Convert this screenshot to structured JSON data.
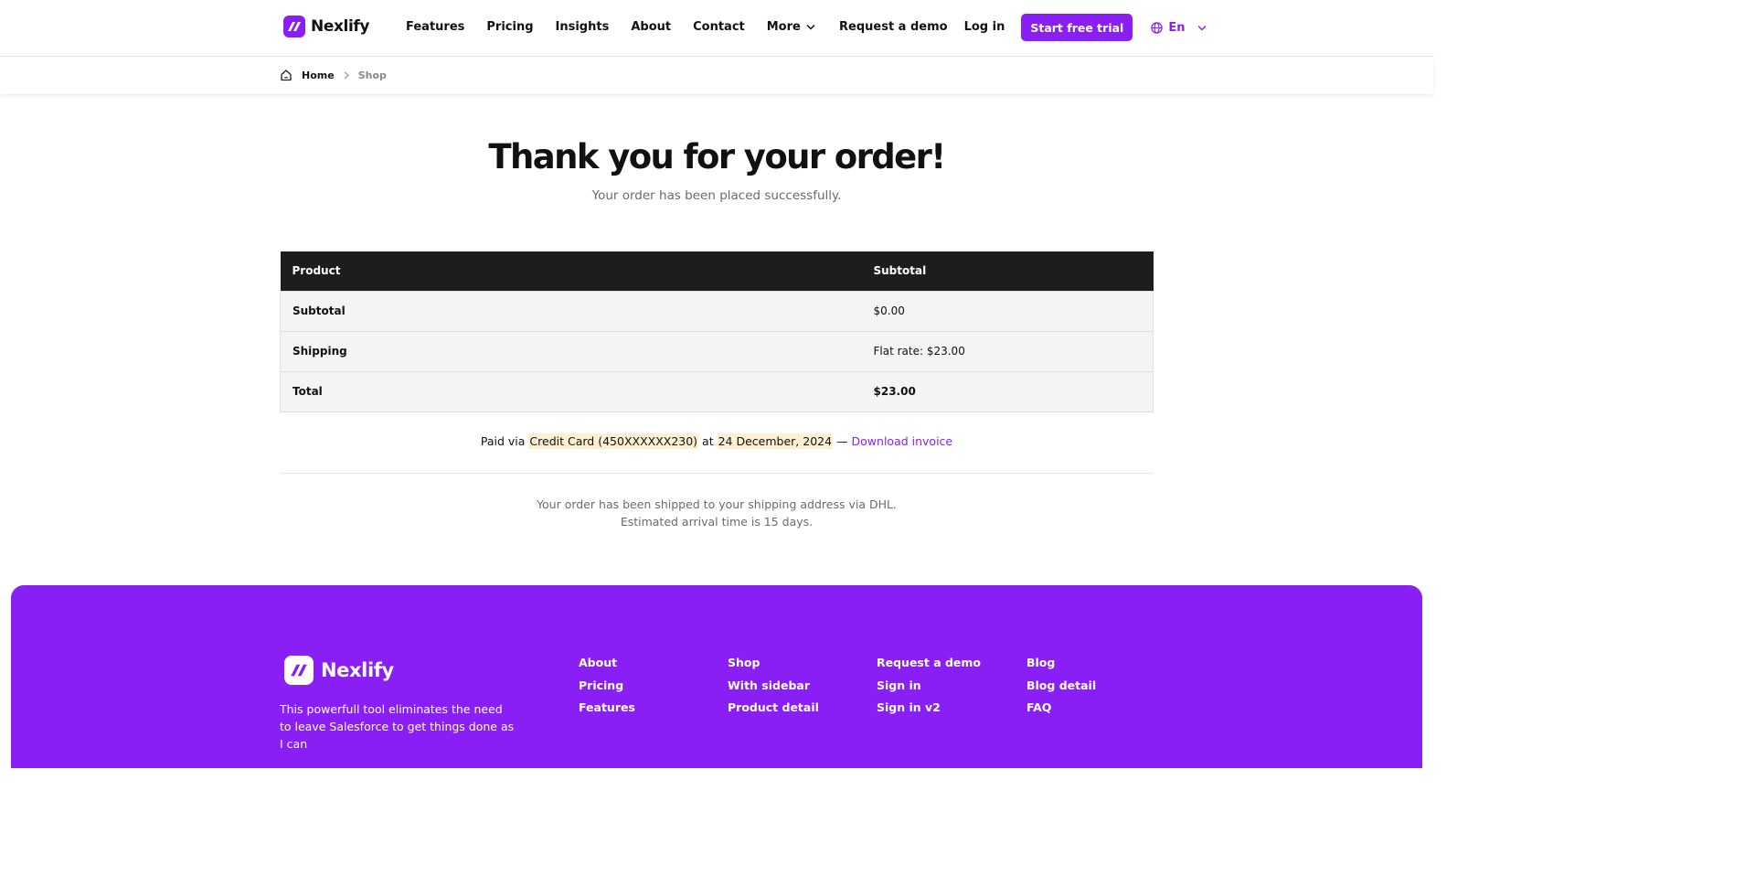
{
  "brand": {
    "name": "Nexlify",
    "accent": "#8a1ff5",
    "dark": "#1d1c1f"
  },
  "nav": {
    "items": [
      "Features",
      "Pricing",
      "Insights",
      "About",
      "Contact",
      "More"
    ],
    "request_demo": "Request a demo",
    "login": "Log in",
    "trial": "Start free trial",
    "lang": "En"
  },
  "breadcrumb": {
    "home": "Home",
    "current": "Shop"
  },
  "main": {
    "title": "Thank you for your order!",
    "subtitle": "Your order has been placed successfully."
  },
  "table": {
    "headers": [
      "Product",
      "Subtotal"
    ],
    "rows": [
      {
        "label": "Subtotal",
        "value": "$0.00"
      },
      {
        "label": "Shipping",
        "value": "Flat rate: $23.00"
      },
      {
        "label": "Total",
        "value": "$23.00"
      }
    ]
  },
  "payment": {
    "prefix": "Paid via",
    "method": "Credit Card (450XXXXXX230)",
    "at": "at",
    "date": "24 December, 2024",
    "dash": "—",
    "invoice": "Download invoice"
  },
  "shipping_note": {
    "line1": "Your order has been shipped to your shipping address via DHL.",
    "line2": "Estimated arrival time is 15 days."
  },
  "footer": {
    "brand": "Nexlify",
    "description": "This powerfull tool eliminates the need to leave Salesforce to get things done as I can",
    "columns": [
      [
        "About",
        "Pricing",
        "Features"
      ],
      [
        "Shop",
        "With sidebar",
        "Product detail"
      ],
      [
        "Request a demo",
        "Sign in",
        "Sign in v2"
      ],
      [
        "Blog",
        "Blog detail",
        "FAQ"
      ]
    ]
  }
}
